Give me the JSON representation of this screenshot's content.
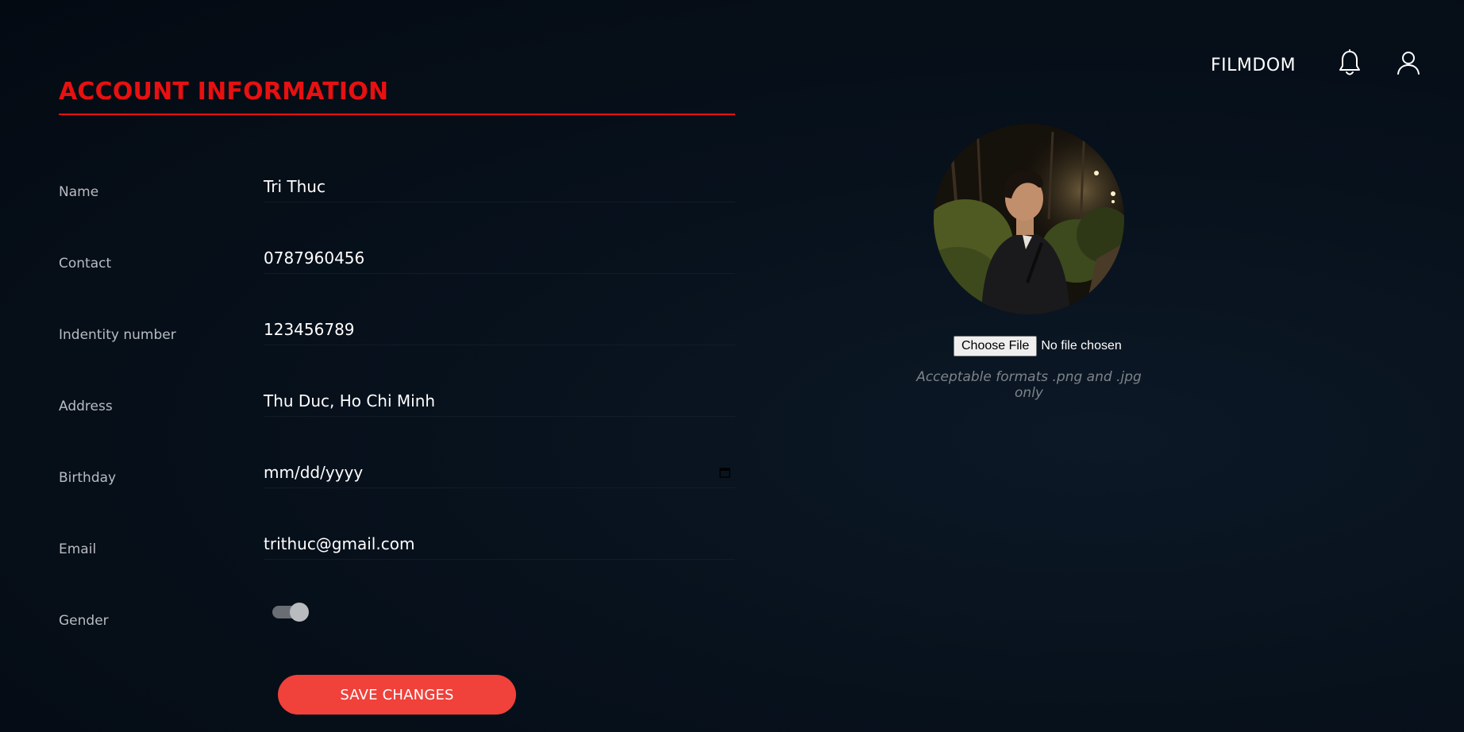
{
  "header": {
    "brand": "FILMDOM",
    "icons": [
      "bell-icon",
      "user-icon"
    ]
  },
  "form": {
    "title": "ACCOUNT INFORMATION",
    "fields": [
      {
        "label": "Name",
        "value": "Tri Thuc"
      },
      {
        "label": "Contact",
        "value": "0787960456"
      },
      {
        "label": "Indentity number",
        "value": "123456789"
      },
      {
        "label": "Address",
        "value": "Thu Duc, Ho Chi Minh"
      },
      {
        "label": "Birthday",
        "value": "mm/dd/yyyy"
      },
      {
        "label": "Email",
        "value": "trithuc@gmail.com"
      }
    ],
    "gender_label": "Gender",
    "save_label": "SAVE CHANGES"
  },
  "avatar": {
    "choose_file_label": "Choose File",
    "file_status": "No file chosen",
    "formats_note": "Acceptable formats .png and .jpg only"
  },
  "colors": {
    "accent": "#e81010",
    "save_button": "#f0413a",
    "background": "#07111c"
  }
}
